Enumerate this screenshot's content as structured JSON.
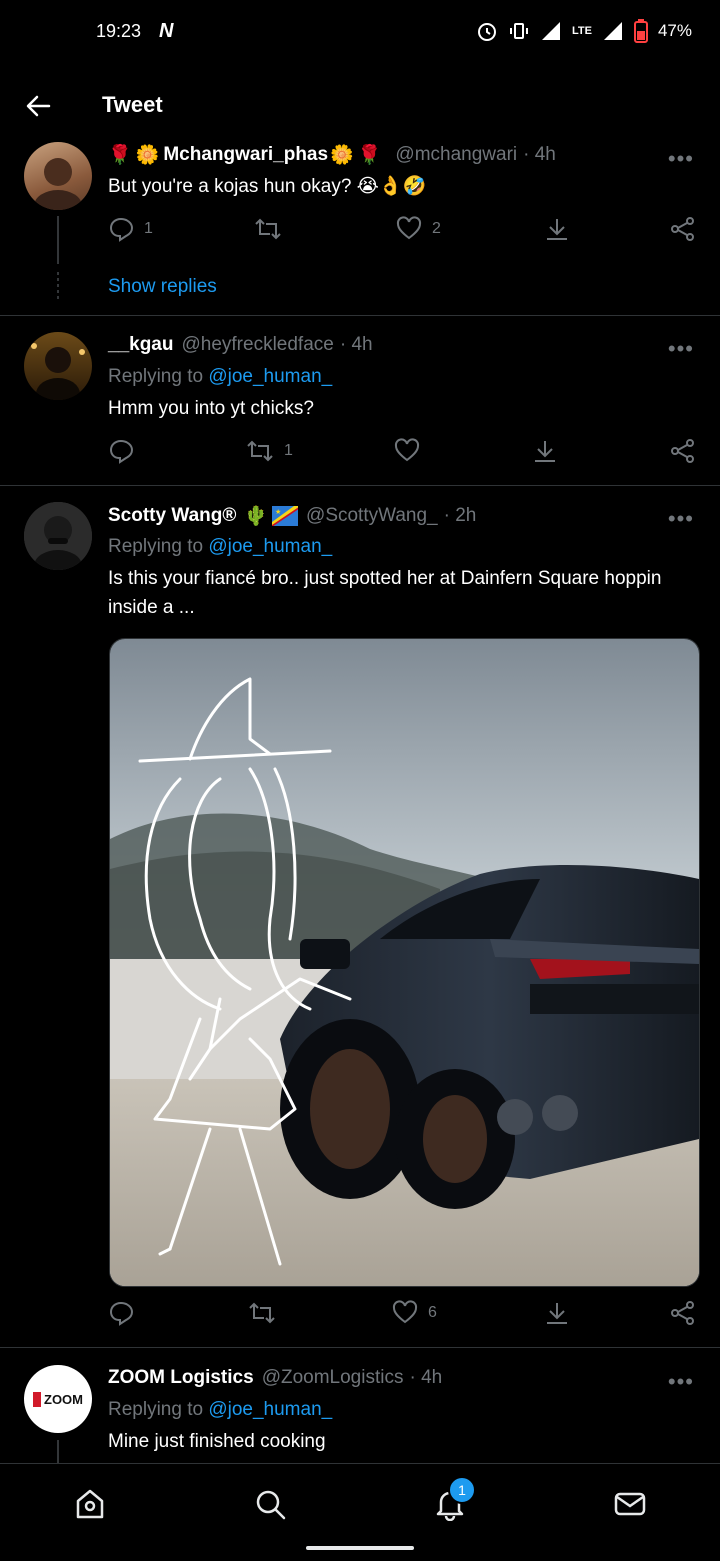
{
  "status_bar": {
    "time": "19:23",
    "network": "LTE",
    "battery": "47%"
  },
  "header": {
    "title": "Tweet"
  },
  "tweets": [
    {
      "name": "Mchangwari_phas",
      "handle": "@mchangwari",
      "time": "· 4h",
      "replying_to": "",
      "text": "But you're a kojas hun okay? 😭👌🤣",
      "counts": {
        "replies": "1",
        "retweets": "",
        "likes": "2"
      },
      "show_replies": "Show replies"
    },
    {
      "name": "__kgau",
      "handle": "@heyfreckledface",
      "time": "· 4h",
      "replying_prefix": "Replying to ",
      "replying_to": "@joe_human_",
      "text": "Hmm you into yt chicks?",
      "counts": {
        "replies": "",
        "retweets": "1",
        "likes": ""
      }
    },
    {
      "name": "Scotty Wang®",
      "name_emoji": "🌵",
      "handle": "@ScottyWang_",
      "time": "· 2h",
      "replying_prefix": "Replying to ",
      "replying_to": "@joe_human_",
      "text": "Is this your fiancé bro.. just spotted her at Dainfern Square hoppin inside a ...",
      "counts": {
        "replies": "",
        "retweets": "",
        "likes": "6"
      }
    },
    {
      "name": "ZOOM Logistics",
      "handle": "@ZoomLogistics",
      "time": "· 4h",
      "replying_prefix": "Replying to ",
      "replying_to": "@joe_human_",
      "text": "Mine just finished cooking",
      "avatar_logo": "ZOOM"
    }
  ],
  "bottom_nav": {
    "notifications_badge": "1"
  },
  "colors": {
    "accent": "#1d9bf0",
    "background": "#000000",
    "muted": "#71767b",
    "divider": "#2f3336"
  },
  "icons": [
    "back-arrow-icon",
    "more-icon",
    "reply-icon",
    "retweet-icon",
    "like-icon",
    "download-icon",
    "share-icon",
    "home-icon",
    "search-icon",
    "bell-icon",
    "mail-icon"
  ]
}
